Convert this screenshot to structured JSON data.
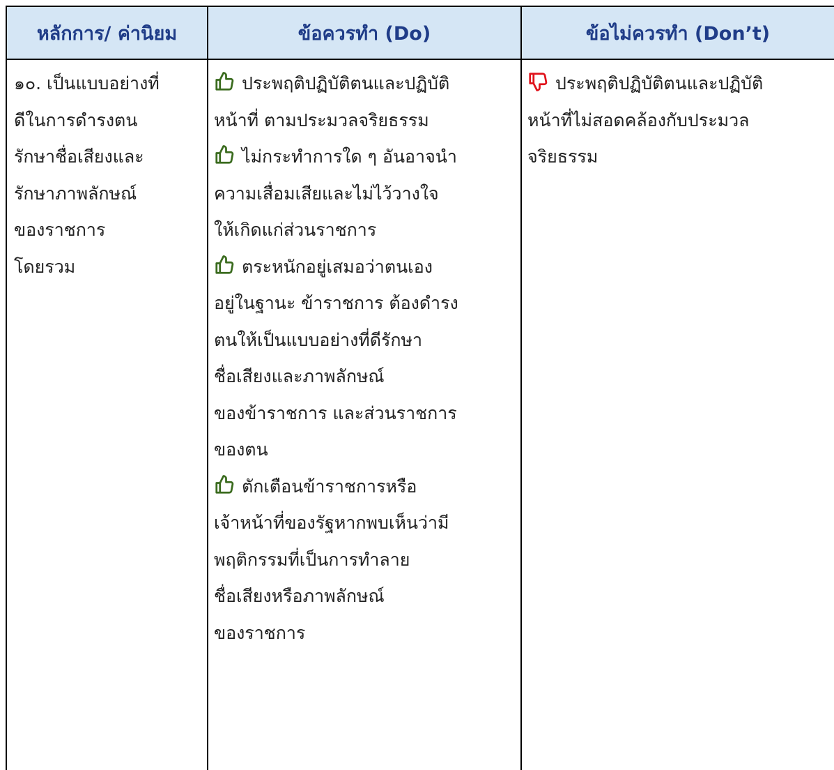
{
  "table": {
    "headers": {
      "principle": "หลักการ/ ค่านิยม",
      "do": "ข้อควรทำ (Do)",
      "dont": "ข้อไม่ควรทำ (Don’t)"
    },
    "principle": {
      "lines": [
        "๑๐. เป็นแบบอย่างที่",
        "ดีในการดำรงตน",
        "รักษาชื่อเสียงและ",
        "รักษาภาพลักษณ์",
        "ของราชการ",
        "โดยรวม"
      ]
    },
    "do_items": [
      {
        "icon": "thumbs-up-icon",
        "lines": [
          "ประพฤติปฏิบัติตนและปฏิบัติ",
          "หน้าที่ ตามประมวลจริยธรรม"
        ]
      },
      {
        "icon": "thumbs-up-icon",
        "lines": [
          "ไม่กระทำการใด ๆ อันอาจนำ",
          "ความเสื่อมเสียและไม่ไว้วางใจ",
          "ให้เกิดแก่ส่วนราชการ"
        ]
      },
      {
        "icon": "thumbs-up-icon",
        "lines": [
          "ตระหนักอยู่เสมอว่าตนเอง",
          "อยู่ในฐานะ ข้าราชการ ต้องดำรง",
          "ตนให้เป็นแบบอย่างที่ดีรักษา",
          "ชื่อเสียงและภาพลักษณ์",
          "ของข้าราชการ และส่วนราชการ",
          "ของตน"
        ]
      },
      {
        "icon": "thumbs-up-icon",
        "lines": [
          "ตักเตือนข้าราชการหรือ",
          "เจ้าหน้าที่ของรัฐหากพบเห็นว่ามี",
          "พฤติกรรมที่เป็นการทำลาย",
          "ชื่อเสียงหรือภาพลักษณ์",
          "ของราชการ"
        ]
      }
    ],
    "dont_items": [
      {
        "icon": "thumbs-down-icon",
        "lines": [
          "ประพฤติปฏิบัติตนและปฏิบัติ",
          "หน้าที่ไม่สอดคล้องกับประมวล",
          "จริยธรรม"
        ]
      }
    ]
  },
  "colors": {
    "header_bg": "#d5e6f5",
    "header_text": "#1f3c88",
    "thumbs_up": "#3a6b1e",
    "thumbs_down": "#e0121b"
  }
}
